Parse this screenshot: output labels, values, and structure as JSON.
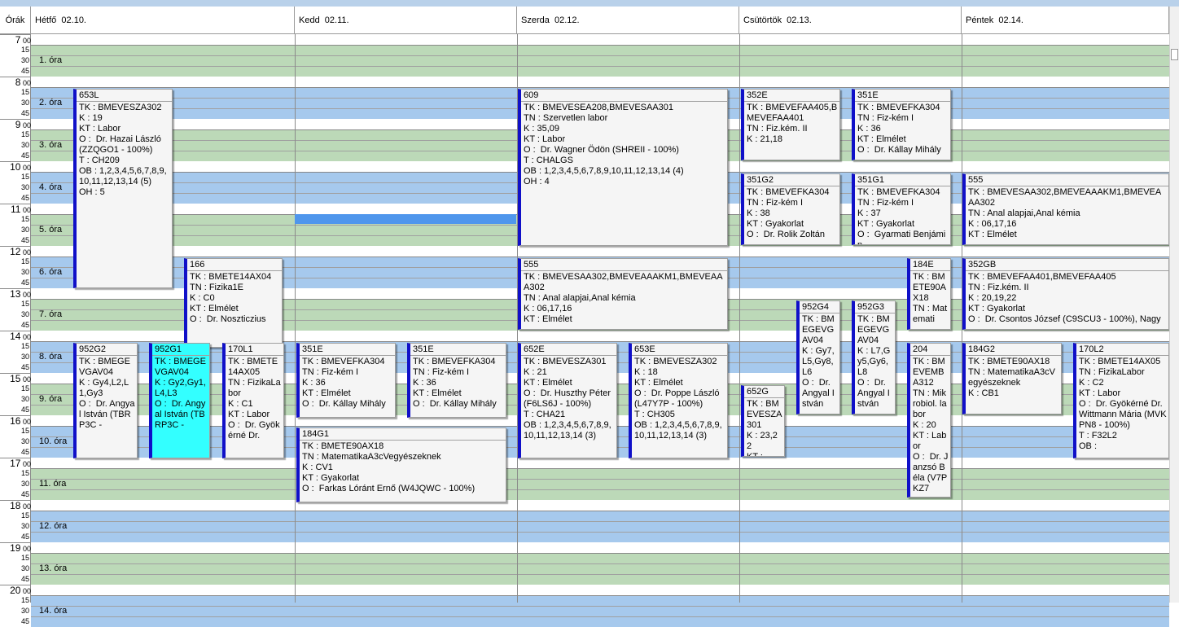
{
  "header": {
    "hours_label": "Órák",
    "days": [
      {
        "name": "Hétfő  02.10."
      },
      {
        "name": "Kedd  02.11."
      },
      {
        "name": "Szerda  02.12."
      },
      {
        "name": "Csütörtök  02.13."
      },
      {
        "name": "Péntek  02.14."
      }
    ]
  },
  "hours": [
    "7",
    "8",
    "9",
    "10",
    "11",
    "12",
    "13",
    "14",
    "15",
    "16",
    "17",
    "18",
    "19",
    "20"
  ],
  "minutes": [
    "00",
    "15",
    "30",
    "45"
  ],
  "periods": [
    "1. óra",
    "2. óra",
    "3. óra",
    "4. óra",
    "5. óra",
    "6. óra",
    "7. óra",
    "8. óra",
    "9. óra",
    "10. óra",
    "11. óra",
    "12. óra",
    "13. óra",
    "14. óra"
  ],
  "colors": {
    "band_blue": "#a6c9ed",
    "band_green": "#bcd9b8",
    "event_accent": "#1010c8",
    "selected": "#33ffff",
    "highlight": "#4f96ec"
  },
  "events": [
    {
      "code": "653L",
      "lines": [
        "TK : BMEVESZA302",
        "K : 19",
        "KT : Labor",
        "O :  Dr. Hazai László (ZZQGO1 - 100%)",
        "T : CH209",
        "OB : 1,2,3,4,5,6,7,8,9,10,11,12,13,14 (5)",
        "OH : 5"
      ]
    },
    {
      "code": "166",
      "lines": [
        "TK : BMETE14AX04",
        "TN : Fizika1E",
        "K : C0",
        "KT : Elmélet",
        "O :  Dr. Noszticzius"
      ]
    },
    {
      "code": "952G2",
      "lines": [
        "TK : BMEGEVGAV04",
        "K : Gy4,L2,L1,Gy3",
        "O :  Dr. Angyal István (TBRP3C -"
      ]
    },
    {
      "code": "952G1",
      "lines": [
        "TK : BMEGEVGAV04",
        "K : Gy2,Gy1,L4,L3",
        "O :  Dr. Angyal István (TBRP3C -"
      ]
    },
    {
      "code": "170L1",
      "lines": [
        "TK : BMETE14AX05",
        "TN : FizikaLabor",
        "K : C1",
        "KT : Labor",
        "O :  Dr. Gyökérné Dr."
      ]
    },
    {
      "code": "351E",
      "lines": [
        "TK : BMEVEFKA304",
        "TN : Fiz-kém I",
        "K : 36",
        "KT : Elmélet",
        "O :  Dr. Kállay Mihály"
      ]
    },
    {
      "code": "351E",
      "lines": [
        "TK : BMEVEFKA304",
        "TN : Fiz-kém I",
        "K : 36",
        "KT : Elmélet",
        "O :  Dr. Kállay Mihály"
      ]
    },
    {
      "code": "184G1",
      "lines": [
        "TK : BMETE90AX18",
        "TN : MatematikaA3cVegyészeknek",
        "K : CV1",
        "KT : Gyakorlat",
        "O :  Farkas Lóránt Ernő (W4JQWC - 100%)"
      ]
    },
    {
      "code": "609",
      "lines": [
        "TK : BMEVESEA208,BMEVESAA301",
        "TN : Szervetlen labor",
        "K : 35,09",
        "KT : Labor",
        "O :  Dr. Wagner Ödön (SHREII - 100%)",
        "T : CHALGS",
        "OB : 1,2,3,4,5,6,7,8,9,10,11,12,13,14 (4)",
        "OH : 4"
      ]
    },
    {
      "code": "555",
      "lines": [
        "TK : BMEVESAA302,BMEVEAAAKM1,BMEVEAAA302",
        "TN : Anal alapjai,Anal kémia",
        "K : 06,17,16",
        "KT : Elmélet"
      ]
    },
    {
      "code": "652E",
      "lines": [
        "TK : BMEVESZA301",
        "K : 21",
        "KT : Elmélet",
        "O :  Dr. Huszthy Péter (F6LS6J - 100%)",
        "T : CHA21",
        "OB : 1,2,3,4,5,6,7,8,9,10,11,12,13,14 (3)"
      ]
    },
    {
      "code": "653E",
      "lines": [
        "TK : BMEVESZA302",
        "K : 18",
        "KT : Elmélet",
        "O :  Dr. Poppe László (L47Y7P - 100%)",
        "T : CH305",
        "OB : 1,2,3,4,5,6,7,8,9,10,11,12,13,14 (3)"
      ]
    },
    {
      "code": "352E",
      "lines": [
        "TK : BMEVEFAA405,BMEVEFAA401",
        "TN : Fiz.kém. II",
        "K : 21,18"
      ]
    },
    {
      "code": "351E",
      "lines": [
        "TK : BMEVEFKA304",
        "TN : Fiz-kém I",
        "K : 36",
        "KT : Elmélet",
        "O :  Dr. Kállay Mihály"
      ]
    },
    {
      "code": "351G2",
      "lines": [
        "TK : BMEVEFKA304",
        "TN : Fiz-kém I",
        "K : 38",
        "KT : Gyakorlat",
        "O :  Dr. Rolik Zoltán"
      ]
    },
    {
      "code": "351G1",
      "lines": [
        "TK : BMEVEFKA304",
        "TN : Fiz-kém I",
        "K : 37",
        "KT : Gyakorlat",
        "O :  Gyarmati Benjámin"
      ]
    },
    {
      "code": "952G4",
      "lines": [
        "TK : BMEGEVGAV04",
        "K : Gy7,L5,Gy8,L6",
        "O :  Dr. Angyal István"
      ]
    },
    {
      "code": "952G3",
      "lines": [
        "TK : BMEGEVGAV04",
        "K : L7,Gy5,Gy6,L8",
        "O :  Dr. Angyal István"
      ]
    },
    {
      "code": "184E",
      "lines": [
        "TK : BMETE90AX18",
        "TN : Matemati"
      ]
    },
    {
      "code": "204",
      "lines": [
        "TK : BMEVEMBA312",
        "TN : Mikrobiol. labor",
        "K : 20",
        "KT : Labor",
        "O :  Dr. Janzsó Béla (V7PKZ7"
      ]
    },
    {
      "code": "652G",
      "lines": [
        "TK : BMEVESZA301",
        "K : 23,22",
        "KT :"
      ]
    },
    {
      "code": "555",
      "lines": [
        "TK : BMEVESAA302,BMEVEAAAKM1,BMEVEAAA302",
        "TN : Anal alapjai,Anal kémia",
        "K : 06,17,16",
        "KT : Elmélet"
      ]
    },
    {
      "code": "352GB",
      "lines": [
        "TK : BMEVEFAA401,BMEVEFAA405",
        "TN : Fiz.kém. II",
        "K : 20,19,22",
        "KT : Gyakorlat",
        "O :  Dr. Csontos József (C9SCU3 - 100%), Nagy"
      ]
    },
    {
      "code": "184G2",
      "lines": [
        "TK : BMETE90AX18",
        "TN : MatematikaA3cVegyészeknek",
        "K : CB1"
      ]
    },
    {
      "code": "170L2",
      "lines": [
        "TK : BMETE14AX05",
        "TN : FizikaLabor",
        "K : C2",
        "KT : Labor",
        "O :  Dr. Gyökérné Dr. Wittmann Mária (MVKPN8 - 100%)",
        "T : F32L2",
        "OB :"
      ]
    }
  ]
}
